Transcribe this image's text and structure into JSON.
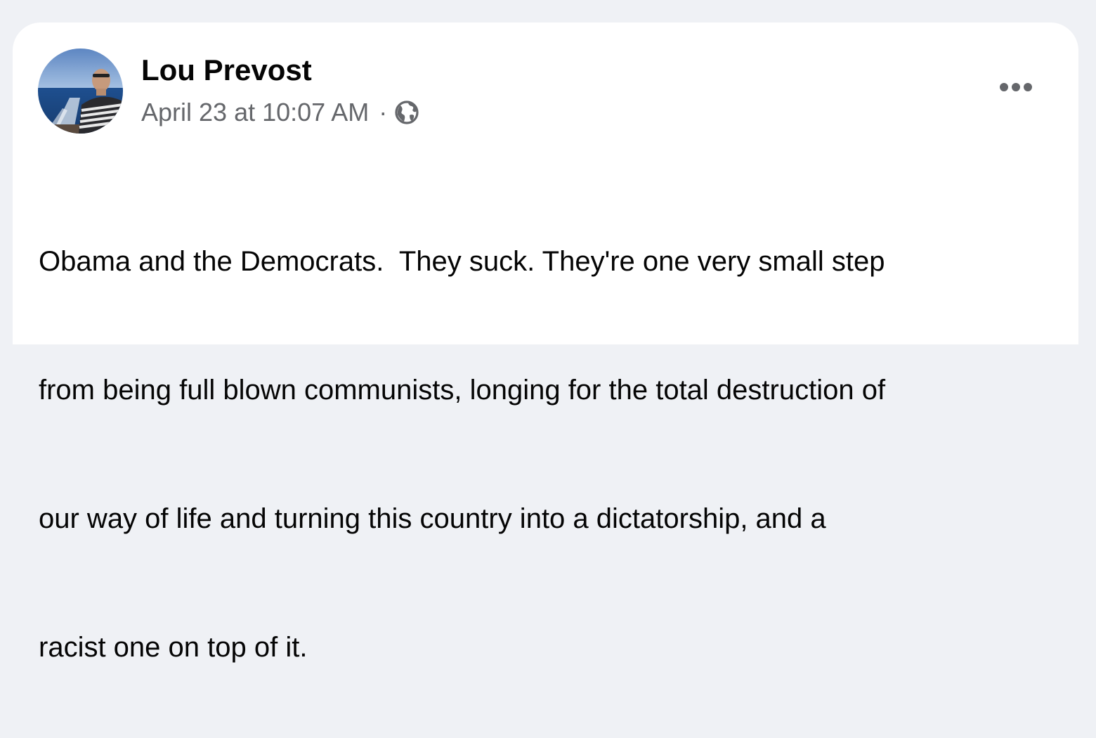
{
  "post": {
    "author": "Lou Prevost",
    "timestamp": "April 23 at 10:07 AM",
    "separator": "·",
    "audience_icon": "globe-icon",
    "more_icon": "more-horizontal-icon",
    "lines": [
      "Obama and the Democrats.  They suck. They're one very small step",
      "from being full blown communists, longing for the total destruction of",
      "our way of life and turning this country into a dictatorship, and a",
      "racist one on top of it."
    ]
  },
  "colors": {
    "page_background": "#eff1f5",
    "card_background": "#ffffff",
    "primary_text": "#050505",
    "secondary_text": "#65676b"
  }
}
